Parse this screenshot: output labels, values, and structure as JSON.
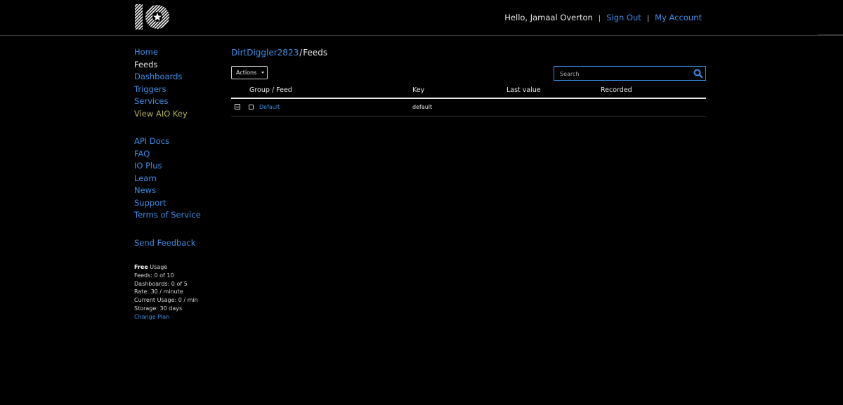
{
  "header": {
    "logo": "IO",
    "greeting": "Hello, Jamaal Overton",
    "separator": "|",
    "sign_out": "Sign Out",
    "my_account": "My Account"
  },
  "sidebar": {
    "primary": [
      {
        "label": "Home"
      },
      {
        "label": "Feeds"
      },
      {
        "label": "Dashboards"
      },
      {
        "label": "Triggers"
      },
      {
        "label": "Services"
      },
      {
        "label": "View AIO Key"
      }
    ],
    "secondary": [
      {
        "label": "API Docs"
      },
      {
        "label": "FAQ"
      },
      {
        "label": "IO Plus"
      },
      {
        "label": "Learn"
      },
      {
        "label": "News"
      },
      {
        "label": "Support"
      },
      {
        "label": "Terms of Service"
      }
    ],
    "feedback": "Send Feedback",
    "usage": {
      "plan": "Free",
      "plan_suffix": "Usage",
      "feeds": "Feeds: 0 of 10",
      "dashboards": "Dashboards: 0 of 5",
      "rate": "Rate: 30 / minute",
      "current": "Current Usage: 0 / min",
      "storage": "Storage: 30 days",
      "change_plan": "Change Plan"
    }
  },
  "main": {
    "breadcrumb": {
      "user": "DirtDiggler2823",
      "separator": "/",
      "page": "Feeds"
    },
    "actions_label": "Actions",
    "search": {
      "placeholder": "Search",
      "value": ""
    },
    "table": {
      "headers": [
        "Group / Feed",
        "Key",
        "Last value",
        "Recorded"
      ],
      "rows": [
        {
          "feed": "Default",
          "key": "default",
          "last_value": "",
          "recorded": ""
        }
      ]
    }
  },
  "colors": {
    "background": "#000000",
    "link": "#3a8ee6",
    "key_link": "#b3b35a",
    "text": "#e8e8e8"
  }
}
